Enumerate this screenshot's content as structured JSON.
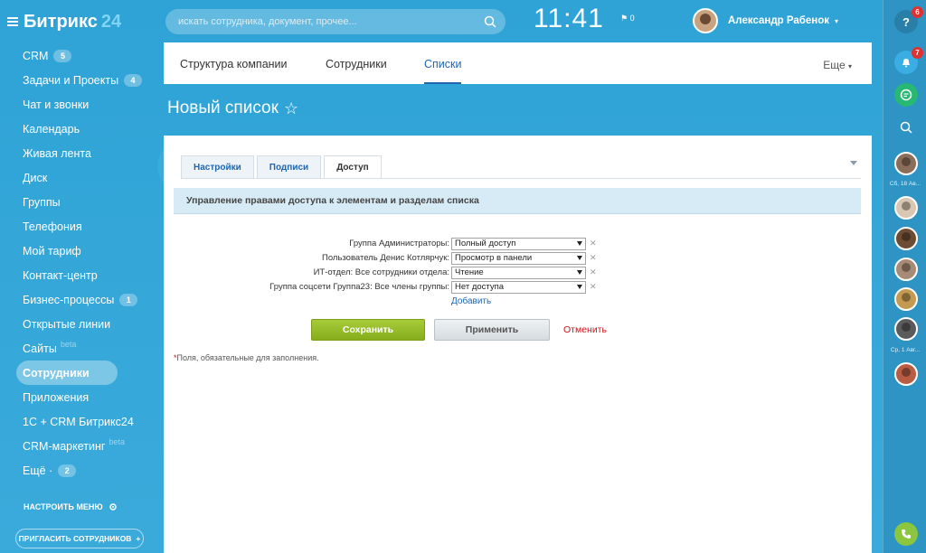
{
  "logo": {
    "text": "Битрикс",
    "num": "24"
  },
  "sidebar": {
    "items": [
      {
        "label": "CRM",
        "counter": "5"
      },
      {
        "label": "Задачи и Проекты",
        "counter": "4"
      },
      {
        "label": "Чат и звонки"
      },
      {
        "label": "Календарь"
      },
      {
        "label": "Живая лента"
      },
      {
        "label": "Диск"
      },
      {
        "label": "Группы"
      },
      {
        "label": "Телефония"
      },
      {
        "label": "Мой тариф"
      },
      {
        "label": "Контакт-центр"
      },
      {
        "label": "Бизнес-процессы",
        "counter": "1"
      },
      {
        "label": "Открытые линии"
      },
      {
        "label": "Сайты",
        "beta": "beta"
      },
      {
        "label": "Сотрудники",
        "active": true
      },
      {
        "label": "Приложения"
      },
      {
        "label": "1С + CRM Битрикс24"
      },
      {
        "label": "CRM-маркетинг",
        "beta": "beta"
      },
      {
        "label": "Ещё ·",
        "counter": "2"
      }
    ],
    "setup_menu": "НАСТРОИТЬ МЕНЮ",
    "invite": "ПРИГЛАСИТЬ СОТРУДНИКОВ"
  },
  "header": {
    "search_placeholder": "искать сотрудника, документ, прочее...",
    "clock": "11:41",
    "flag_count": "0",
    "user_name": "Александр Рабенок"
  },
  "top_tabs": [
    {
      "label": "Структура компании"
    },
    {
      "label": "Сотрудники"
    },
    {
      "label": "Списки",
      "active": true
    }
  ],
  "more_label": "Еще",
  "page_title": "Новый список",
  "form_tabs": [
    {
      "label": "Настройки"
    },
    {
      "label": "Подписи"
    },
    {
      "label": "Доступ",
      "active": true
    }
  ],
  "section_header": "Управление правами доступа к элементам и разделам списка",
  "permissions": [
    {
      "label": "Группа Администраторы:",
      "value": "Полный доступ"
    },
    {
      "label": "Пользователь Денис Котлярчук:",
      "value": "Просмотр в панели"
    },
    {
      "label": "ИТ-отдел: Все сотрудники отдела:",
      "value": "Чтение"
    },
    {
      "label": "Группа соцсети Группа23: Все члены группы:",
      "value": "Нет доступа"
    }
  ],
  "add_link": "Добавить",
  "buttons": {
    "save": "Сохранить",
    "apply": "Применить",
    "cancel": "Отменить"
  },
  "required_note": "Поля, обязательные для заполнения.",
  "rail": {
    "help_badge": "6",
    "bell_badge": "7",
    "date1": "Сб, 18 Ав...",
    "date2": "Ср, 1 Авг..."
  },
  "colors": {
    "accent": "#2067b0",
    "save": "#8fb82a",
    "cancel": "#d3131a",
    "bg": "#2fa4d8"
  }
}
